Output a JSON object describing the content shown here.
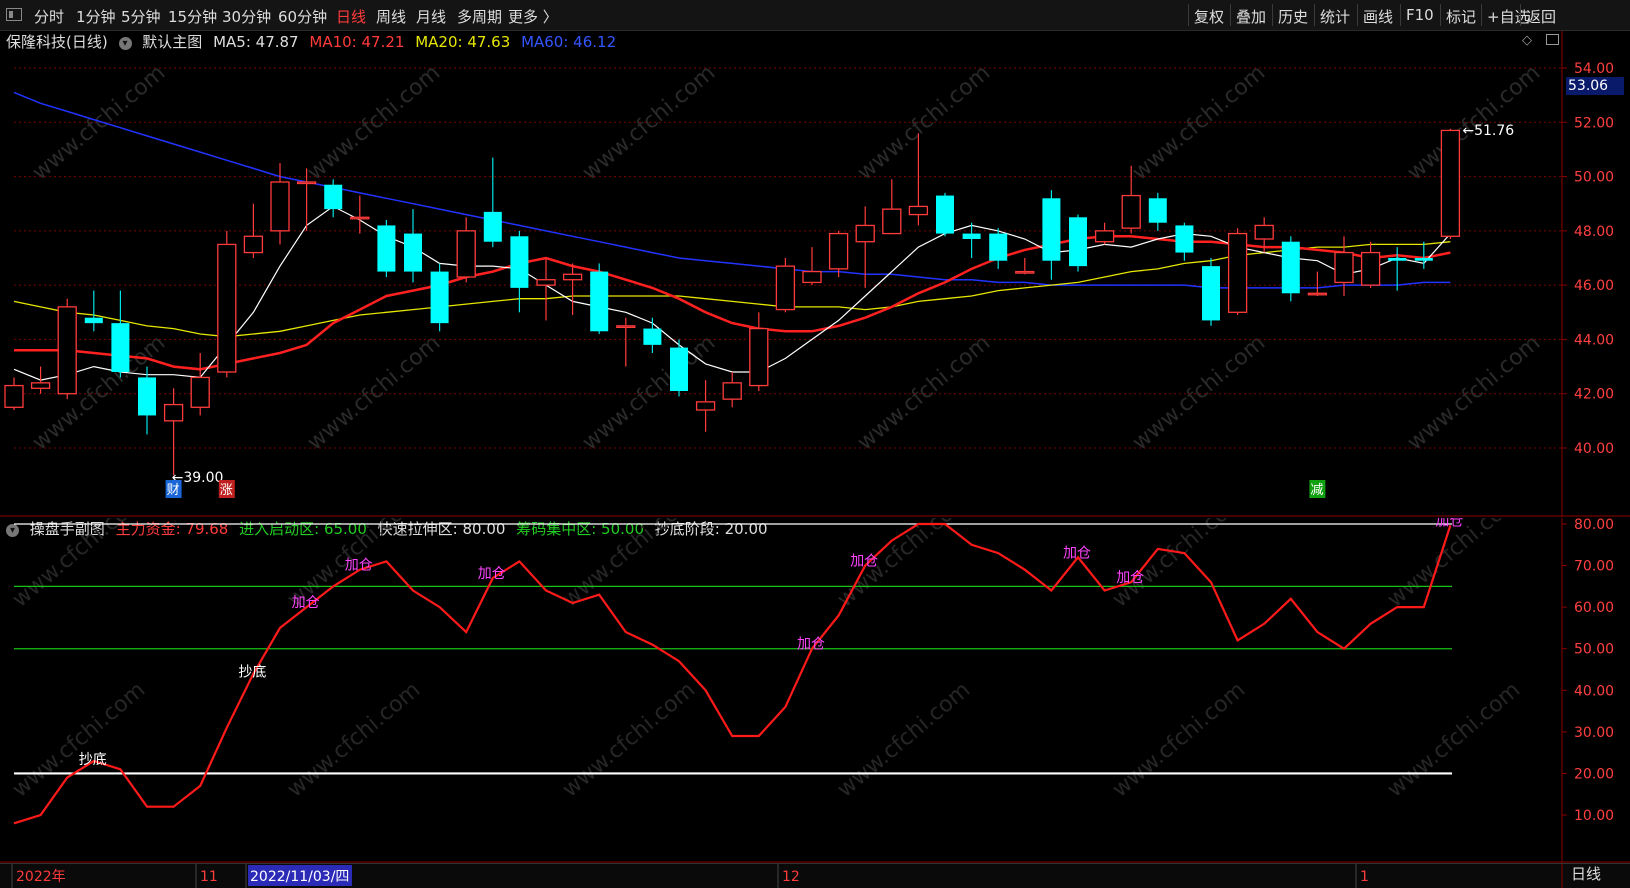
{
  "toolbar": {
    "left_items": [
      {
        "label": "分时",
        "active": false
      },
      {
        "label": "1分钟",
        "active": false
      },
      {
        "label": "5分钟",
        "active": false
      },
      {
        "label": "15分钟",
        "active": false
      },
      {
        "label": "30分钟",
        "active": false
      },
      {
        "label": "60分钟",
        "active": false
      },
      {
        "label": "日线",
        "active": true
      },
      {
        "label": "周线",
        "active": false
      },
      {
        "label": "月线",
        "active": false
      },
      {
        "label": "多周期",
        "active": false
      },
      {
        "label": "更多 〉",
        "active": false
      }
    ],
    "right_items": [
      "复权",
      "叠加",
      "历史",
      "统计",
      "画线",
      "F10",
      "标记",
      "+自选",
      "返回"
    ]
  },
  "main_chart": {
    "stock": "保隆科技(日线)",
    "template": "默认主图",
    "ma5": "MA5: 47.87",
    "ma10": "MA10: 47.21",
    "ma20": "MA20: 47.63",
    "ma60": "MA60: 46.12",
    "current_price_tag": "53.06",
    "high_label": "51.76",
    "low_label": "39.00",
    "markers": [
      "财",
      "涨",
      "减"
    ],
    "y_ticks": [
      "54.00",
      "52.00",
      "50.00",
      "48.00",
      "46.00",
      "44.00",
      "42.00",
      "40.00"
    ],
    "colors": {
      "up": "#ff3b3b",
      "down": "#00ffff",
      "ma5": "#ffffff",
      "ma10": "#ff2020",
      "ma20": "#e6e600",
      "ma60": "#2233ff",
      "grid": "#7a0000"
    }
  },
  "sub_chart": {
    "title": "操盘手副图",
    "main_fund": "主力资金: 79.68",
    "start_zone": "进入启动区: 65.00",
    "fast_zone": "快速拉伸区: 80.00",
    "chip_zone": "筹码集中区: 50.00",
    "bottom_stage": "抄底阶段: 20.00",
    "y_ticks": [
      "80.00",
      "70.00",
      "60.00",
      "50.00",
      "40.00",
      "30.00",
      "20.00",
      "10.00"
    ],
    "signal_labels": [
      "抄底",
      "抄底",
      "加仓",
      "加仓",
      "加仓",
      "加仓",
      "加仓",
      "加仓",
      "加仓",
      "加仓"
    ]
  },
  "date_axis": {
    "labels": [
      "2022年",
      "11",
      "2022/11/03/四",
      "12",
      "1"
    ]
  },
  "period_button": "日线",
  "watermark": "www.cfchi.com",
  "chart_data": {
    "type": "candlestick",
    "candles": [
      {
        "o": 41.5,
        "c": 42.3,
        "h": 42.6,
        "l": 41.4
      },
      {
        "o": 42.2,
        "c": 42.4,
        "h": 43.0,
        "l": 42.0
      },
      {
        "o": 42.0,
        "c": 45.2,
        "h": 45.5,
        "l": 41.8
      },
      {
        "o": 44.8,
        "c": 44.6,
        "h": 45.8,
        "l": 44.3
      },
      {
        "o": 44.6,
        "c": 42.8,
        "h": 45.8,
        "l": 42.6
      },
      {
        "o": 42.6,
        "c": 41.2,
        "h": 43.0,
        "l": 40.5
      },
      {
        "o": 41.0,
        "c": 41.6,
        "h": 42.2,
        "l": 39.0
      },
      {
        "o": 41.5,
        "c": 42.6,
        "h": 43.5,
        "l": 41.2
      },
      {
        "o": 42.8,
        "c": 47.5,
        "h": 48.0,
        "l": 42.6
      },
      {
        "o": 47.2,
        "c": 47.8,
        "h": 49.0,
        "l": 47.0
      },
      {
        "o": 48.0,
        "c": 49.8,
        "h": 50.5,
        "l": 47.5
      },
      {
        "o": 49.8,
        "c": 49.8,
        "h": 50.3,
        "l": 48.0
      },
      {
        "o": 49.7,
        "c": 48.8,
        "h": 49.9,
        "l": 48.5
      },
      {
        "o": 48.5,
        "c": 48.5,
        "h": 49.3,
        "l": 47.9
      },
      {
        "o": 48.2,
        "c": 46.5,
        "h": 48.4,
        "l": 46.3
      },
      {
        "o": 47.9,
        "c": 46.5,
        "h": 48.8,
        "l": 46.1
      },
      {
        "o": 46.5,
        "c": 44.6,
        "h": 46.8,
        "l": 44.3
      },
      {
        "o": 46.3,
        "c": 48.0,
        "h": 48.5,
        "l": 46.1
      },
      {
        "o": 48.7,
        "c": 47.6,
        "h": 50.7,
        "l": 47.4
      },
      {
        "o": 47.8,
        "c": 45.9,
        "h": 48.0,
        "l": 45.0
      },
      {
        "o": 46.0,
        "c": 46.2,
        "h": 47.0,
        "l": 44.7
      },
      {
        "o": 46.2,
        "c": 46.4,
        "h": 46.8,
        "l": 44.9
      },
      {
        "o": 46.5,
        "c": 44.3,
        "h": 46.8,
        "l": 44.2
      },
      {
        "o": 44.5,
        "c": 44.5,
        "h": 44.8,
        "l": 43.0
      },
      {
        "o": 44.4,
        "c": 43.8,
        "h": 44.8,
        "l": 43.5
      },
      {
        "o": 43.7,
        "c": 42.1,
        "h": 44.0,
        "l": 41.9
      },
      {
        "o": 41.4,
        "c": 41.7,
        "h": 42.5,
        "l": 40.6
      },
      {
        "o": 41.8,
        "c": 42.4,
        "h": 42.8,
        "l": 41.5
      },
      {
        "o": 42.3,
        "c": 44.4,
        "h": 45.0,
        "l": 42.1
      },
      {
        "o": 45.1,
        "c": 46.7,
        "h": 47.0,
        "l": 45.0
      },
      {
        "o": 46.1,
        "c": 46.5,
        "h": 47.4,
        "l": 46.0
      },
      {
        "o": 46.6,
        "c": 47.9,
        "h": 48.0,
        "l": 46.3
      },
      {
        "o": 47.6,
        "c": 48.2,
        "h": 48.9,
        "l": 45.9
      },
      {
        "o": 47.9,
        "c": 48.8,
        "h": 49.9,
        "l": 47.9
      },
      {
        "o": 48.6,
        "c": 48.9,
        "h": 51.6,
        "l": 48.2
      },
      {
        "o": 49.3,
        "c": 47.9,
        "h": 49.4,
        "l": 47.8
      },
      {
        "o": 47.9,
        "c": 47.7,
        "h": 48.3,
        "l": 47.0
      },
      {
        "o": 47.9,
        "c": 46.9,
        "h": 48.1,
        "l": 46.6
      },
      {
        "o": 46.5,
        "c": 46.5,
        "h": 47.0,
        "l": 46.4
      },
      {
        "o": 49.2,
        "c": 46.9,
        "h": 49.5,
        "l": 46.2
      },
      {
        "o": 48.5,
        "c": 46.7,
        "h": 48.6,
        "l": 46.5
      },
      {
        "o": 47.6,
        "c": 48.0,
        "h": 48.3,
        "l": 47.5
      },
      {
        "o": 48.1,
        "c": 49.3,
        "h": 50.4,
        "l": 47.9
      },
      {
        "o": 49.2,
        "c": 48.3,
        "h": 49.4,
        "l": 48.0
      },
      {
        "o": 48.2,
        "c": 47.2,
        "h": 48.3,
        "l": 46.9
      },
      {
        "o": 46.7,
        "c": 44.7,
        "h": 47.0,
        "l": 44.5
      },
      {
        "o": 45.0,
        "c": 47.9,
        "h": 48.1,
        "l": 44.9
      },
      {
        "o": 47.7,
        "c": 48.2,
        "h": 48.5,
        "l": 47.2
      },
      {
        "o": 47.6,
        "c": 45.7,
        "h": 47.8,
        "l": 45.4
      },
      {
        "o": 45.7,
        "c": 45.7,
        "h": 46.5,
        "l": 45.6
      },
      {
        "o": 46.1,
        "c": 47.2,
        "h": 47.8,
        "l": 45.6
      },
      {
        "o": 46.0,
        "c": 47.2,
        "h": 47.6,
        "l": 45.9
      },
      {
        "o": 47.0,
        "c": 46.9,
        "h": 47.4,
        "l": 45.8
      },
      {
        "o": 47.0,
        "c": 46.9,
        "h": 47.6,
        "l": 46.6
      },
      {
        "o": 47.8,
        "c": 51.7,
        "h": 51.76,
        "l": 47.7
      }
    ],
    "ma5": [
      42.9,
      42.5,
      42.7,
      43.0,
      42.8,
      42.7,
      42.7,
      42.6,
      43.8,
      45.0,
      46.7,
      48.2,
      48.9,
      48.4,
      47.8,
      47.4,
      46.8,
      46.7,
      46.7,
      46.6,
      46.0,
      45.4,
      45.2,
      45.0,
      44.6,
      43.8,
      43.1,
      42.8,
      42.8,
      43.3,
      44.0,
      44.7,
      45.6,
      46.5,
      47.4,
      47.9,
      48.2,
      48.0,
      47.7,
      47.2,
      47.3,
      47.5,
      47.4,
      47.7,
      47.9,
      47.8,
      47.4,
      47.2,
      47.0,
      46.9,
      46.4,
      46.6,
      47.0,
      46.8,
      47.9
    ],
    "ma10": [
      43.6,
      43.6,
      43.6,
      43.5,
      43.4,
      43.3,
      43.0,
      42.9,
      43.1,
      43.3,
      43.5,
      43.8,
      44.6,
      45.1,
      45.6,
      45.8,
      46.0,
      46.3,
      46.5,
      46.8,
      47.0,
      46.7,
      46.5,
      46.2,
      45.9,
      45.5,
      45.0,
      44.6,
      44.4,
      44.3,
      44.3,
      44.5,
      44.8,
      45.2,
      45.7,
      46.1,
      46.6,
      47.0,
      47.3,
      47.5,
      47.7,
      47.8,
      47.8,
      47.7,
      47.6,
      47.6,
      47.5,
      47.4,
      47.4,
      47.3,
      47.2,
      47.0,
      47.1,
      47.0,
      47.2
    ],
    "ma20": [
      45.4,
      45.2,
      45.0,
      44.9,
      44.7,
      44.5,
      44.4,
      44.2,
      44.1,
      44.2,
      44.3,
      44.5,
      44.7,
      44.9,
      45.0,
      45.1,
      45.2,
      45.3,
      45.4,
      45.5,
      45.5,
      45.6,
      45.6,
      45.6,
      45.6,
      45.6,
      45.5,
      45.4,
      45.3,
      45.2,
      45.2,
      45.2,
      45.1,
      45.2,
      45.4,
      45.5,
      45.6,
      45.8,
      45.9,
      46.0,
      46.1,
      46.3,
      46.5,
      46.6,
      46.8,
      46.9,
      47.1,
      47.2,
      47.3,
      47.4,
      47.4,
      47.5,
      47.5,
      47.5,
      47.6
    ],
    "ma60": [
      53.1,
      52.7,
      52.4,
      52.1,
      51.8,
      51.5,
      51.2,
      50.9,
      50.6,
      50.3,
      50.0,
      49.8,
      49.6,
      49.4,
      49.2,
      49.0,
      48.8,
      48.6,
      48.4,
      48.2,
      48.0,
      47.8,
      47.6,
      47.4,
      47.2,
      47.0,
      46.9,
      46.8,
      46.7,
      46.6,
      46.5,
      46.5,
      46.4,
      46.4,
      46.3,
      46.2,
      46.2,
      46.1,
      46.1,
      46.0,
      46.0,
      46.0,
      46.0,
      46.0,
      46.0,
      45.9,
      45.9,
      45.9,
      45.9,
      45.9,
      46.0,
      46.0,
      46.0,
      46.1,
      46.1
    ],
    "indicator_line": [
      8,
      10,
      19,
      23,
      21,
      12,
      12,
      17,
      31,
      44,
      55,
      60,
      65,
      69,
      71,
      64,
      60,
      54,
      67,
      71,
      64,
      61,
      63,
      54,
      51,
      47,
      40,
      29,
      29,
      36,
      50,
      58,
      70,
      76,
      80,
      80,
      75,
      73,
      69,
      64,
      72,
      64,
      66,
      74,
      73,
      66,
      52,
      56,
      62,
      54,
      50,
      56,
      60,
      60,
      79.68
    ],
    "levels": [
      {
        "name": "进入启动区",
        "value": 65,
        "color": "#18c018"
      },
      {
        "name": "快速拉伸区",
        "value": 80,
        "color": "#ffffff"
      },
      {
        "name": "筹码集中区",
        "value": 50,
        "color": "#18c018"
      },
      {
        "name": "抄底阶段",
        "value": 20,
        "color": "#ffffff"
      }
    ]
  }
}
